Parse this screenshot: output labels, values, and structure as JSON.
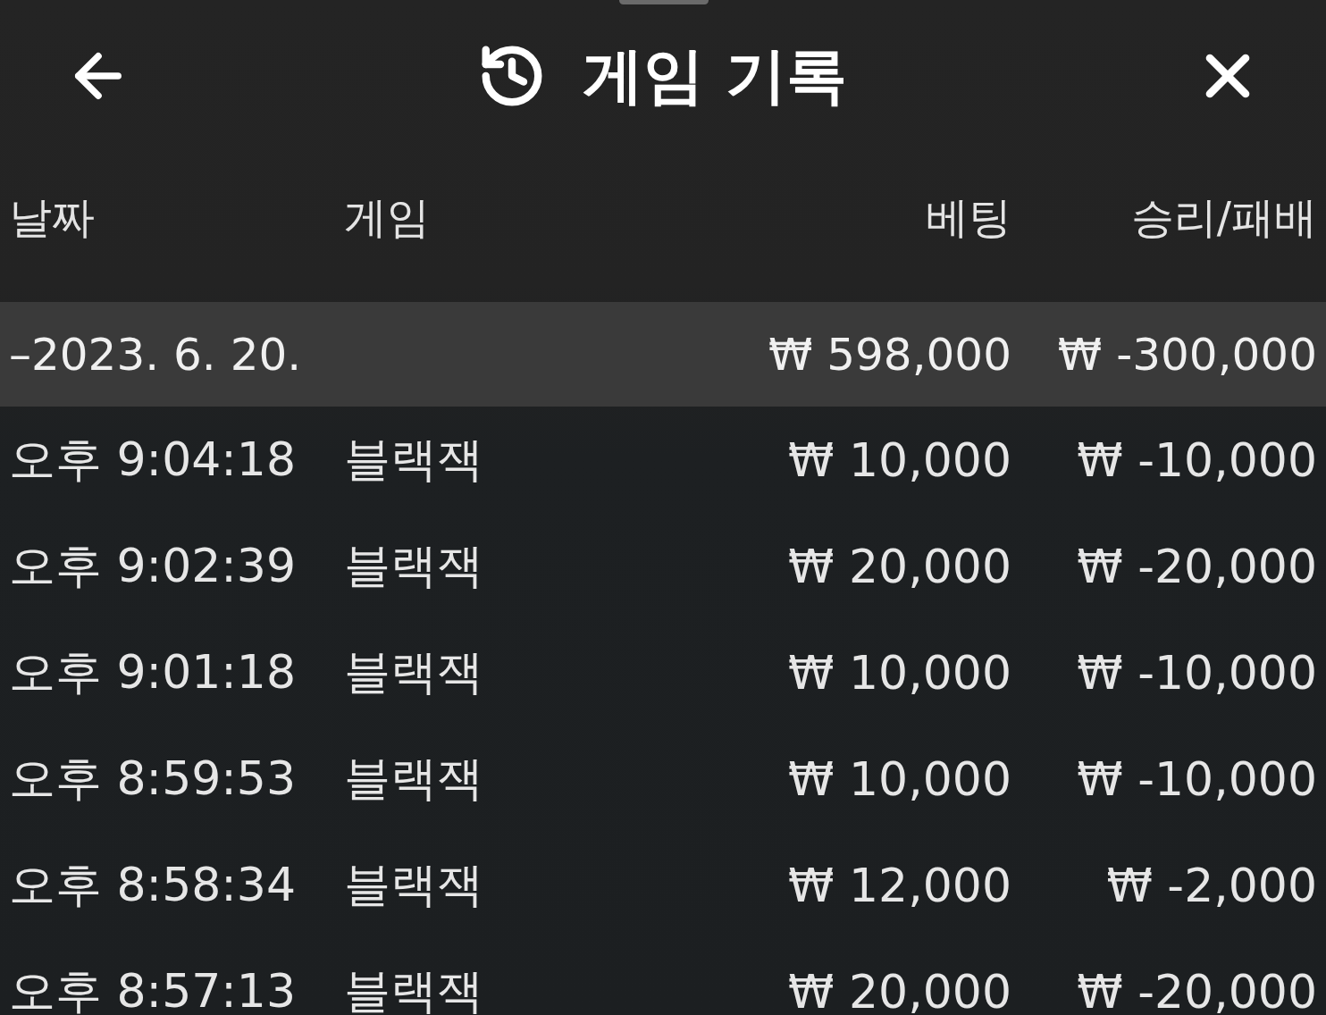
{
  "header": {
    "title": "게임 기록"
  },
  "columns": [
    "날짜",
    "게임",
    "베팅",
    "승리/패배"
  ],
  "groups": [
    {
      "date": "–2023. 6. 20.",
      "bet": "₩ 598,000",
      "result": "₩ -300,000",
      "rows": [
        {
          "time": "오후 9:04:18",
          "game": "블랙잭",
          "bet": "₩ 10,000",
          "result": "₩ -10,000"
        },
        {
          "time": "오후 9:02:39",
          "game": "블랙잭",
          "bet": "₩ 20,000",
          "result": "₩ -20,000"
        },
        {
          "time": "오후 9:01:18",
          "game": "블랙잭",
          "bet": "₩ 10,000",
          "result": "₩ -10,000"
        },
        {
          "time": "오후 8:59:53",
          "game": "블랙잭",
          "bet": "₩ 10,000",
          "result": "₩ -10,000"
        },
        {
          "time": "오후 8:58:34",
          "game": "블랙잭",
          "bet": "₩ 12,000",
          "result": "₩ -2,000"
        },
        {
          "time": "오후 8:57:13",
          "game": "블랙잭",
          "bet": "₩ 20,000",
          "result": "₩ -20,000"
        }
      ]
    }
  ]
}
